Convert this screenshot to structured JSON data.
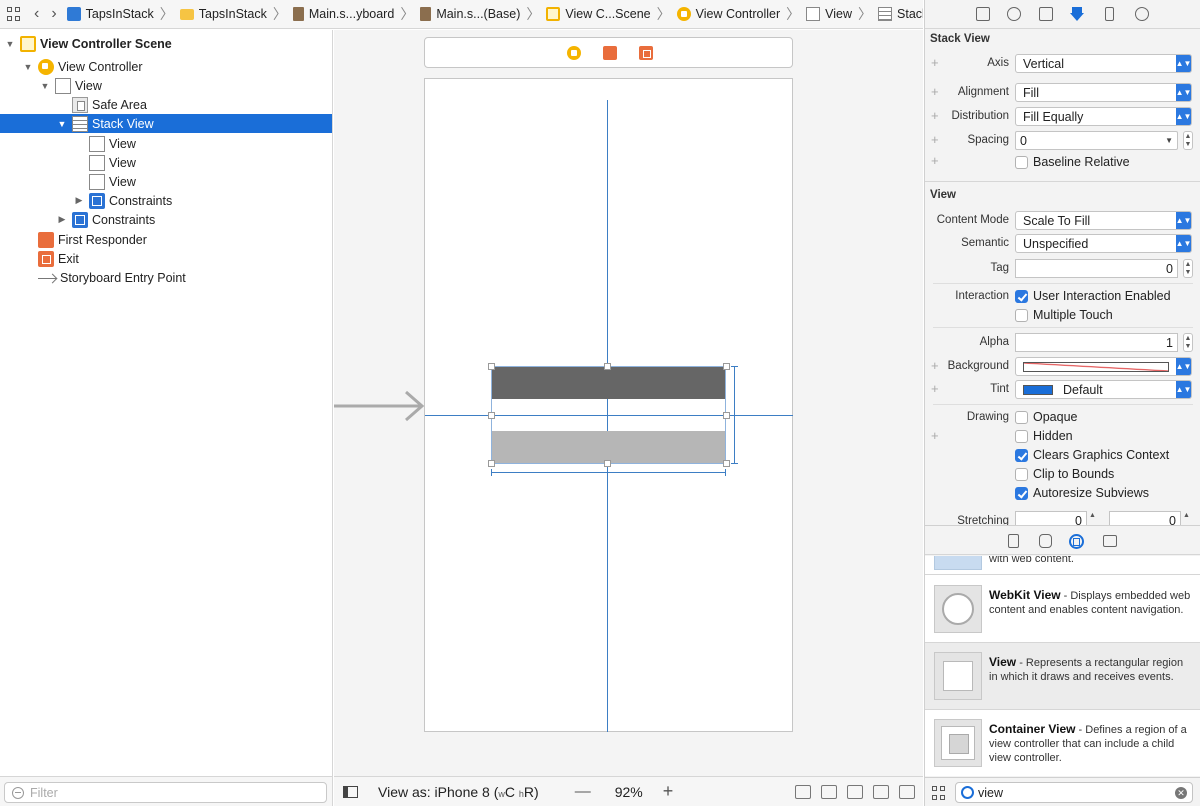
{
  "breadcrumbs": [
    {
      "label": "TapsInStack",
      "icon": "project-icon"
    },
    {
      "label": "TapsInStack",
      "icon": "folder-icon"
    },
    {
      "label": "Main.s...yboard",
      "icon": "storyboard-file-icon"
    },
    {
      "label": "Main.s...(Base)",
      "icon": "storyboard-file-icon"
    },
    {
      "label": "View C...Scene",
      "icon": "scene-icon"
    },
    {
      "label": "View Controller",
      "icon": "view-controller-icon"
    },
    {
      "label": "View",
      "icon": "view-icon"
    },
    {
      "label": "Stack View",
      "icon": "stack-view-icon"
    }
  ],
  "outline": {
    "scene": "View Controller Scene",
    "view_controller": "View Controller",
    "view": "View",
    "safe_area": "Safe Area",
    "stack_view": "Stack View",
    "sub_views": [
      "View",
      "View",
      "View"
    ],
    "stack_constraints": "Constraints",
    "view_constraints": "Constraints",
    "first_responder": "First Responder",
    "exit": "Exit",
    "entry_point": "Storyboard Entry Point",
    "filter_placeholder": "Filter"
  },
  "canvas_bar": {
    "view_as": "View as: iPhone 8",
    "size_class_w": "w",
    "size_class_c": "C",
    "size_class_h": "h",
    "size_class_r": "R",
    "zoom_out": "—",
    "zoom": "92%",
    "zoom_in": "+"
  },
  "inspector": {
    "stack_view": {
      "title": "Stack View",
      "axis_label": "Axis",
      "axis_value": "Vertical",
      "alignment_label": "Alignment",
      "alignment_value": "Fill",
      "distribution_label": "Distribution",
      "distribution_value": "Fill Equally",
      "spacing_label": "Spacing",
      "spacing_value": "0",
      "baseline_relative": "Baseline Relative"
    },
    "view": {
      "title": "View",
      "content_mode_label": "Content Mode",
      "content_mode_value": "Scale To Fill",
      "semantic_label": "Semantic",
      "semantic_value": "Unspecified",
      "tag_label": "Tag",
      "tag_value": "0",
      "interaction_label": "Interaction",
      "user_interaction": "User Interaction Enabled",
      "multiple_touch": "Multiple Touch",
      "alpha_label": "Alpha",
      "alpha_value": "1",
      "background_label": "Background",
      "tint_label": "Tint",
      "tint_value": "Default",
      "tint_color": "#1a6ed8",
      "drawing_label": "Drawing",
      "opaque": "Opaque",
      "hidden": "Hidden",
      "clears_graphics": "Clears Graphics Context",
      "clip_to_bounds": "Clip to Bounds",
      "autoresize": "Autoresize Subviews",
      "stretching_label": "Stretching",
      "stretch_x": "0",
      "stretch_y": "0"
    }
  },
  "library": {
    "partial_text": "with web content.",
    "items": [
      {
        "name": "WebKit View",
        "desc": " - Displays embedded web content and enables content navigation."
      },
      {
        "name": "View",
        "desc": " - Represents a rectangular region in which it draws and receives events."
      },
      {
        "name": "Container View",
        "desc": " - Defines a region of a view controller that can include a child view controller."
      }
    ],
    "search_value": "view"
  },
  "colors": {
    "selection": "#1a6ed8",
    "accent": "#2b78e0",
    "guide": "#3d7ec4"
  }
}
